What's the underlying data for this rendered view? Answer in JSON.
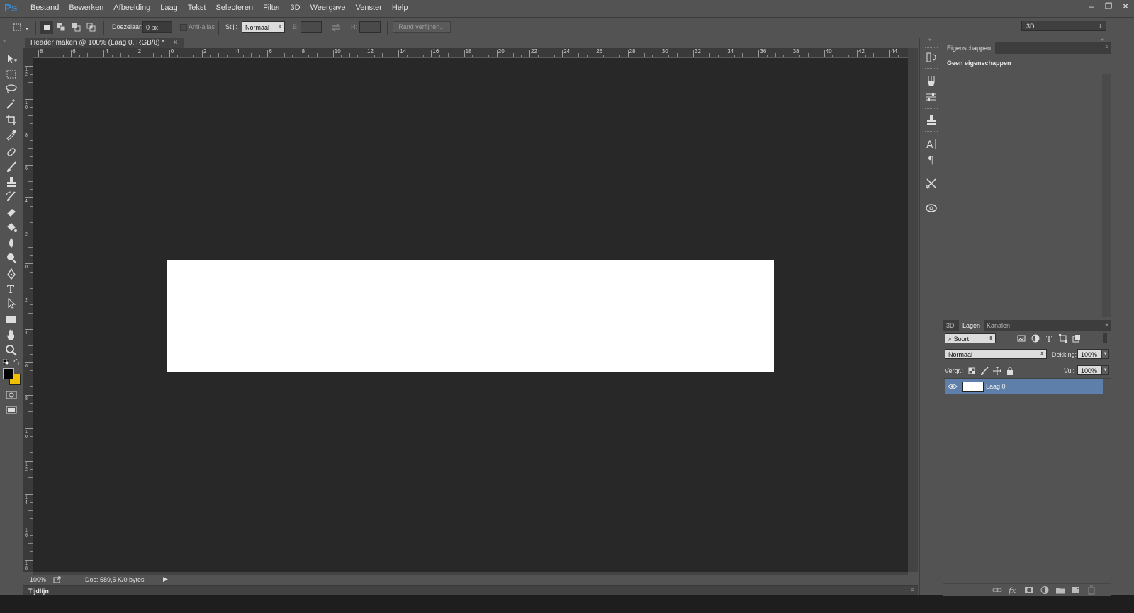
{
  "app": {
    "logo": "Ps"
  },
  "menu": [
    "Bestand",
    "Bewerken",
    "Afbeelding",
    "Laag",
    "Tekst",
    "Selecteren",
    "Filter",
    "3D",
    "Weergave",
    "Venster",
    "Help"
  ],
  "window_controls": {
    "minimize": "–",
    "restore": "❐",
    "close": "✕"
  },
  "options": {
    "feather_label": "Doezelaar:",
    "feather_value": "0 px",
    "antialias_label": "Anti-alias",
    "style_label": "Stijl:",
    "style_value": "Normaal",
    "width_label": "B:",
    "height_label": "H:",
    "refine_label": "Rand verfijnen...",
    "workspace": "3D"
  },
  "document": {
    "tab_title": "Header maken @ 100% (Laag 0, RGB/8) *",
    "tab_close": "×",
    "zoom": "100%",
    "doc_info": "Doc: 589,5 K/0 bytes",
    "ruler_h": [
      "8",
      "6",
      "4",
      "2",
      "0",
      "2",
      "4",
      "6",
      "8",
      "10",
      "12",
      "14",
      "16",
      "18",
      "20",
      "22",
      "24",
      "26",
      "28",
      "30",
      "32",
      "34",
      "36",
      "38",
      "40",
      "42",
      "44"
    ],
    "ruler_v": [
      "12",
      "10",
      "8",
      "6",
      "4",
      "2",
      "0",
      "2",
      "4",
      "6",
      "8",
      "10",
      "12",
      "14",
      "16",
      "18"
    ]
  },
  "timeline": {
    "label": "Tijdlijn"
  },
  "properties": {
    "tab": "Eigenschappen",
    "empty_text": "Geen eigenschappen"
  },
  "layers": {
    "tabs": [
      "3D",
      "Lagen",
      "Kanalen"
    ],
    "filter_value": "Soort",
    "blend_mode": "Normaal",
    "opacity_label": "Dekking:",
    "opacity_value": "100%",
    "lock_label": "Vergr.:",
    "fill_label": "Vul:",
    "fill_value": "100%",
    "items": [
      {
        "name": "Laag 0"
      }
    ]
  },
  "colors": {
    "foreground": "#000000",
    "background": "#f0c000",
    "selected_layer": "#5e7fa9"
  }
}
